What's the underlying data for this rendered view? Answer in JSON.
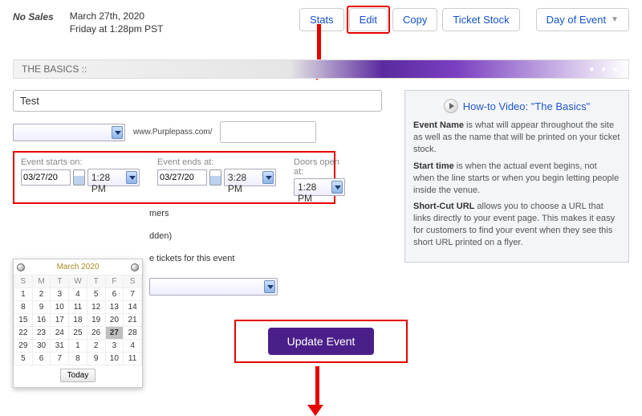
{
  "header": {
    "no_sales": "No Sales",
    "date_line1": "March 27th, 2020",
    "date_line2": "Friday at 1:28pm PST",
    "nav": {
      "stats": "Stats",
      "edit": "Edit",
      "copy": "Copy",
      "ticket_stock": "Ticket Stock",
      "day_of_event": "Day of Event"
    }
  },
  "section_title": "THE BASICS ::",
  "form": {
    "event_name": "Test",
    "url_prefix": "www.Purplepass.com/",
    "url_value": "",
    "start_label": "Event starts on:",
    "start_date": "03/27/20",
    "start_time": "1:28 PM",
    "end_label": "Event ends at:",
    "end_date": "03/27/20",
    "end_time": "3:28 PM",
    "doors_label": "Doors open at:",
    "doors_time": "1:28 PM",
    "trail1": "mers",
    "trail2": "dden)",
    "trail3": "e tickets for this event"
  },
  "calendar": {
    "month": "March 2020",
    "dow": [
      "S",
      "M",
      "T",
      "W",
      "T",
      "F",
      "S"
    ],
    "rows": [
      [
        "1",
        "2",
        "3",
        "4",
        "5",
        "6",
        "7"
      ],
      [
        "8",
        "9",
        "10",
        "11",
        "12",
        "13",
        "14"
      ],
      [
        "15",
        "16",
        "17",
        "18",
        "19",
        "20",
        "21"
      ],
      [
        "22",
        "23",
        "24",
        "25",
        "26",
        "27",
        "28"
      ],
      [
        "29",
        "30",
        "31",
        "1",
        "2",
        "3",
        "4"
      ],
      [
        "5",
        "6",
        "7",
        "8",
        "9",
        "10",
        "11"
      ]
    ],
    "selected": "27",
    "today_label": "Today"
  },
  "help": {
    "video_text": "How-to Video: \"The Basics\"",
    "p1a": "Event Name",
    "p1b": " is what will appear throughout the site as well as the name that will be printed on your ticket stock.",
    "p2a": "Start time",
    "p2b": " is when the actual event begins, not when the line starts or when you begin letting people inside the venue.",
    "p3a": "Short-Cut URL",
    "p3b": " allows you to choose a URL that links directly to your event page. This makes it easy for customers to find your event when they see this short URL printed on a flyer."
  },
  "update_label": "Update Event"
}
